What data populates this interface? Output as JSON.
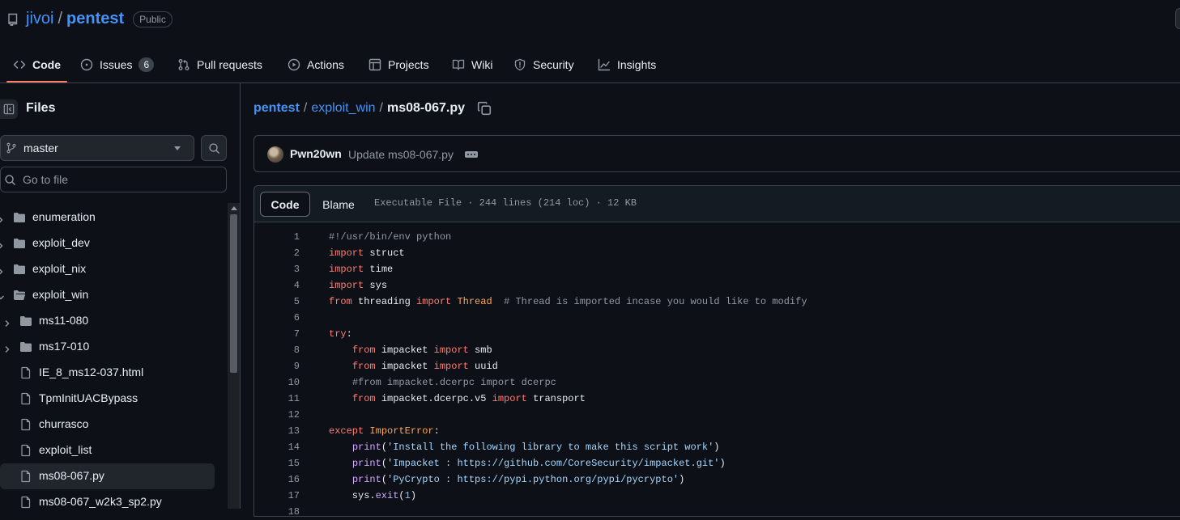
{
  "repo": {
    "owner": "jivoi",
    "separator": "/",
    "name": "pentest",
    "visibility": "Public"
  },
  "nav": {
    "tabs": [
      {
        "label": "Code",
        "icon": "code-icon",
        "active": true
      },
      {
        "label": "Issues",
        "icon": "issue-opened-icon",
        "count": "6"
      },
      {
        "label": "Pull requests",
        "icon": "git-pull-request-icon"
      },
      {
        "label": "Actions",
        "icon": "play-icon"
      },
      {
        "label": "Projects",
        "icon": "table-icon"
      },
      {
        "label": "Wiki",
        "icon": "book-icon"
      },
      {
        "label": "Security",
        "icon": "shield-icon"
      },
      {
        "label": "Insights",
        "icon": "graph-icon"
      }
    ]
  },
  "sidebar": {
    "title": "Files",
    "branch": "master",
    "goto_placeholder": "Go to file",
    "tree": [
      {
        "label": "enumeration",
        "type": "folder",
        "depth": 0,
        "expanded": false
      },
      {
        "label": "exploit_dev",
        "type": "folder",
        "depth": 0,
        "expanded": false
      },
      {
        "label": "exploit_nix",
        "type": "folder",
        "depth": 0,
        "expanded": false
      },
      {
        "label": "exploit_win",
        "type": "folder",
        "depth": 0,
        "expanded": true
      },
      {
        "label": "ms11-080",
        "type": "folder",
        "depth": 1,
        "expanded": false
      },
      {
        "label": "ms17-010",
        "type": "folder",
        "depth": 1,
        "expanded": false
      },
      {
        "label": "IE_8_ms12-037.html",
        "type": "file",
        "depth": 1
      },
      {
        "label": "TpmInitUACBypass",
        "type": "file",
        "depth": 1
      },
      {
        "label": "churrasco",
        "type": "file",
        "depth": 1
      },
      {
        "label": "exploit_list",
        "type": "file",
        "depth": 1
      },
      {
        "label": "ms08-067.py",
        "type": "file",
        "depth": 1,
        "selected": true
      },
      {
        "label": "ms08-067_w2k3_sp2.py",
        "type": "file",
        "depth": 1
      }
    ]
  },
  "breadcrumb": {
    "root": "pentest",
    "sep": "/",
    "folder": "exploit_win",
    "file": "ms08-067.py"
  },
  "commit": {
    "author": "Pwn20wn",
    "message": "Update ms08-067.py"
  },
  "file_view": {
    "tab_code": "Code",
    "tab_blame": "Blame",
    "meta": "Executable File · 244 lines (214 loc) · 12 KB"
  },
  "code_lines": [
    {
      "n": "1",
      "tokens": [
        {
          "t": "#!/usr/bin/env python",
          "c": "cm"
        }
      ]
    },
    {
      "n": "2",
      "tokens": [
        {
          "t": "import",
          "c": "kw"
        },
        {
          "t": " struct",
          "c": ""
        }
      ]
    },
    {
      "n": "3",
      "tokens": [
        {
          "t": "import",
          "c": "kw"
        },
        {
          "t": " time",
          "c": ""
        }
      ]
    },
    {
      "n": "4",
      "tokens": [
        {
          "t": "import",
          "c": "kw"
        },
        {
          "t": " sys",
          "c": ""
        }
      ]
    },
    {
      "n": "5",
      "tokens": [
        {
          "t": "from",
          "c": "kw"
        },
        {
          "t": " threading ",
          "c": ""
        },
        {
          "t": "import",
          "c": "kw"
        },
        {
          "t": " ",
          "c": ""
        },
        {
          "t": "Thread",
          "c": "cls"
        },
        {
          "t": "  ",
          "c": ""
        },
        {
          "t": "# Thread is imported incase you would like to modify",
          "c": "cm"
        }
      ]
    },
    {
      "n": "6",
      "tokens": []
    },
    {
      "n": "7",
      "tokens": [
        {
          "t": "try",
          "c": "kw"
        },
        {
          "t": ":",
          "c": ""
        }
      ]
    },
    {
      "n": "8",
      "tokens": [
        {
          "t": "    ",
          "c": ""
        },
        {
          "t": "from",
          "c": "kw"
        },
        {
          "t": " impacket ",
          "c": ""
        },
        {
          "t": "import",
          "c": "kw"
        },
        {
          "t": " smb",
          "c": ""
        }
      ]
    },
    {
      "n": "9",
      "tokens": [
        {
          "t": "    ",
          "c": ""
        },
        {
          "t": "from",
          "c": "kw"
        },
        {
          "t": " impacket ",
          "c": ""
        },
        {
          "t": "import",
          "c": "kw"
        },
        {
          "t": " uuid",
          "c": ""
        }
      ]
    },
    {
      "n": "10",
      "tokens": [
        {
          "t": "    ",
          "c": ""
        },
        {
          "t": "#from impacket.dcerpc import dcerpc",
          "c": "cm"
        }
      ]
    },
    {
      "n": "11",
      "tokens": [
        {
          "t": "    ",
          "c": ""
        },
        {
          "t": "from",
          "c": "kw"
        },
        {
          "t": " impacket.dcerpc.v5 ",
          "c": ""
        },
        {
          "t": "import",
          "c": "kw"
        },
        {
          "t": " transport",
          "c": ""
        }
      ]
    },
    {
      "n": "12",
      "tokens": []
    },
    {
      "n": "13",
      "tokens": [
        {
          "t": "except",
          "c": "kw"
        },
        {
          "t": " ",
          "c": ""
        },
        {
          "t": "ImportError",
          "c": "cls"
        },
        {
          "t": ":",
          "c": ""
        }
      ]
    },
    {
      "n": "14",
      "tokens": [
        {
          "t": "    ",
          "c": ""
        },
        {
          "t": "print",
          "c": "fn"
        },
        {
          "t": "(",
          "c": ""
        },
        {
          "t": "'Install the following library to make this script work'",
          "c": "str"
        },
        {
          "t": ")",
          "c": ""
        }
      ]
    },
    {
      "n": "15",
      "tokens": [
        {
          "t": "    ",
          "c": ""
        },
        {
          "t": "print",
          "c": "fn"
        },
        {
          "t": "(",
          "c": ""
        },
        {
          "t": "'Impacket : https://github.com/CoreSecurity/impacket.git'",
          "c": "str"
        },
        {
          "t": ")",
          "c": ""
        }
      ]
    },
    {
      "n": "16",
      "tokens": [
        {
          "t": "    ",
          "c": ""
        },
        {
          "t": "print",
          "c": "fn"
        },
        {
          "t": "(",
          "c": ""
        },
        {
          "t": "'PyCrypto : https://pypi.python.org/pypi/pycrypto'",
          "c": "str"
        },
        {
          "t": ")",
          "c": ""
        }
      ]
    },
    {
      "n": "17",
      "tokens": [
        {
          "t": "    sys.",
          "c": ""
        },
        {
          "t": "exit",
          "c": "fn"
        },
        {
          "t": "(",
          "c": ""
        },
        {
          "t": "1",
          "c": "num"
        },
        {
          "t": ")",
          "c": ""
        }
      ]
    },
    {
      "n": "18",
      "tokens": []
    }
  ]
}
